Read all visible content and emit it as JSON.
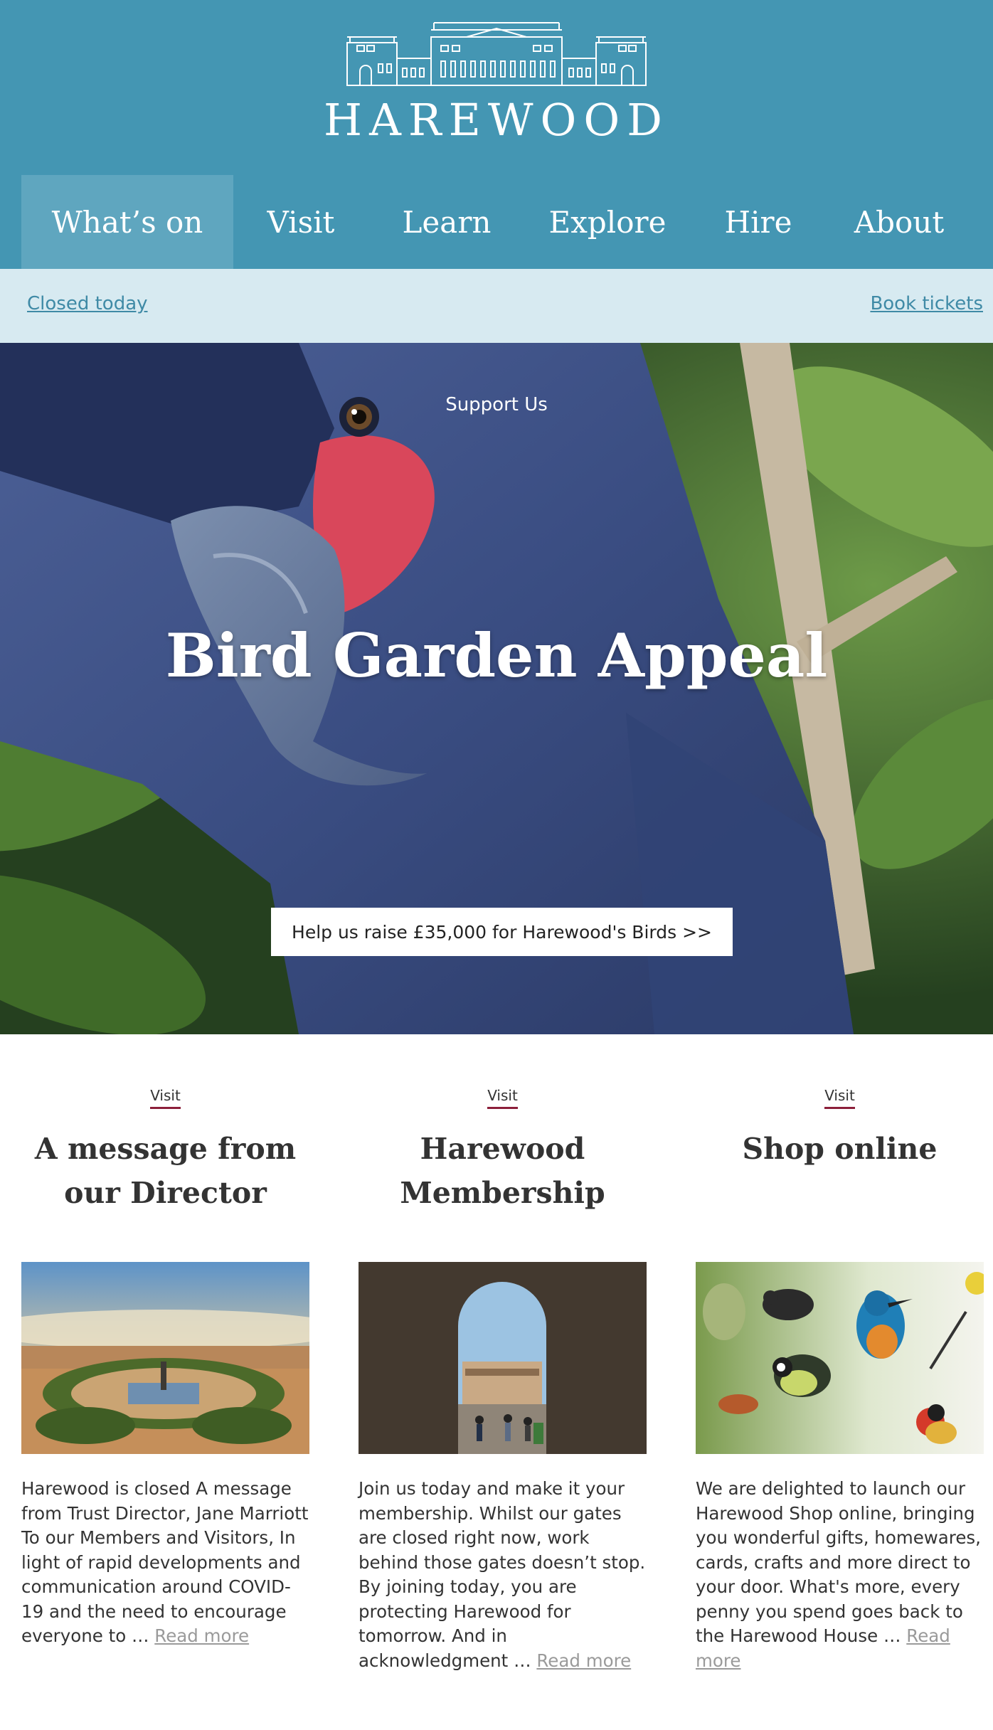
{
  "header": {
    "logo_text": "HAREWOOD",
    "logo_icon": "harewood-house-icon"
  },
  "nav": {
    "items": [
      {
        "label": "What’s on",
        "active": true
      },
      {
        "label": "Visit"
      },
      {
        "label": "Learn"
      },
      {
        "label": "Explore"
      },
      {
        "label": "Hire"
      },
      {
        "label": "About"
      }
    ]
  },
  "notice": {
    "status_link": "Closed today",
    "tickets_link": "Book tickets"
  },
  "hero": {
    "kicker": "Support Us",
    "title": "Bird Garden Appeal",
    "cta": "Help us raise £35,000 for Harewood's Birds >>"
  },
  "cards": [
    {
      "tag": "Visit",
      "title": "A message from our Director",
      "excerpt": "Harewood is closed A message from Trust Director, Jane Marriott To our Members and Visitors, In light of rapid developments and communication around COVID-19 and the need to encourage everyone to …",
      "read_more": "Read more"
    },
    {
      "tag": "Visit",
      "title": "Harewood Membership",
      "excerpt": "Join us today and make it your membership. Whilst our gates are closed right now, work behind those gates doesn’t stop. By joining today, you are protecting Harewood for tomorrow.  And in acknowledgment …",
      "read_more": "Read more"
    },
    {
      "tag": "Visit",
      "title": "Shop online",
      "excerpt": "We are delighted to launch our Harewood Shop online, bringing you wonderful gifts, homewares, cards, crafts and more direct to your door. What's more, every penny you spend goes back to the Harewood House …",
      "read_more": "Read more"
    }
  ],
  "colors": {
    "header_bg": "#4496b3",
    "nav_active_bg": "#5fa6bf",
    "notice_bg": "#d7eaf1",
    "link": "#3f8aa6",
    "tag_underline": "#8c1f3a"
  }
}
